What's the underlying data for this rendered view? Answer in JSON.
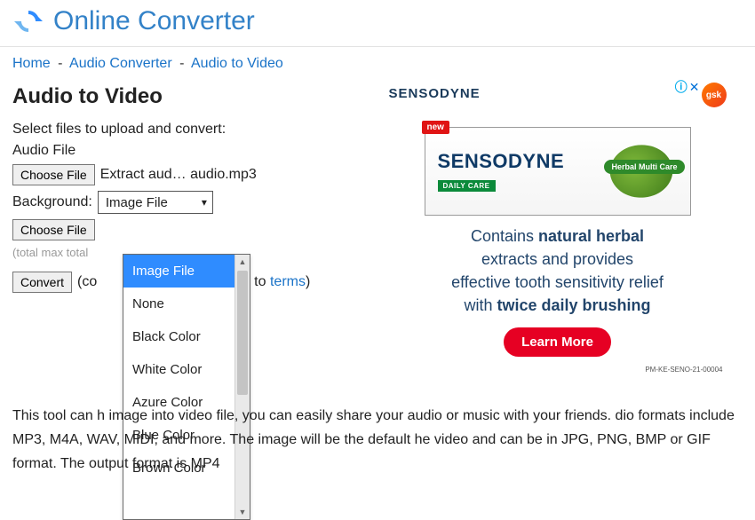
{
  "header": {
    "site_title": "Online Converter"
  },
  "breadcrumb": {
    "items": [
      "Home",
      "Audio Converter",
      "Audio to Video"
    ],
    "sep": "-"
  },
  "page": {
    "title": "Audio to Video",
    "select_prompt": "Select files to upload and convert:",
    "audio_label": "Audio File",
    "choose_file_label": "Choose File",
    "audio_filename": "Extract aud… audio.mp3",
    "background_label": "Background:",
    "background_selected": "Image File",
    "bg_choose_file_label": "Choose File",
    "total_note": "(total max total",
    "convert_label": "Convert",
    "consent_prefix": "(co",
    "consent_mid": "to ",
    "terms_label": "terms",
    "consent_suffix": ")"
  },
  "dropdown": {
    "options": [
      "Image File",
      "None",
      "Black Color",
      "White Color",
      "Azure Color",
      "Blue Color",
      "Brown Color"
    ],
    "selected_index": 0
  },
  "description": "This tool can                           h image into video file, you can easily share your audio or music with your friends.                          dio formats include MP3, M4A, WAV, MIDI, and more. The image will be the default                         he video and can be in JPG, PNG, BMP or GIF format. The output format is MP4",
  "ad": {
    "brand_top": "SENSODYNE",
    "gsk": "gsk",
    "new": "new",
    "prod_brand": "SENSODYNE",
    "prod_sub": "DAILY CARE",
    "herbal": "Herbal Multi Care",
    "copy_line1_a": "Contains ",
    "copy_line1_b": "natural herbal",
    "copy_line2": "extracts and provides",
    "copy_line3": "effective tooth sensitivity relief",
    "copy_line4_a": "with ",
    "copy_line4_b": "twice daily brushing",
    "cta": "Learn More",
    "code": "PM-KE-SENO-21-00004",
    "info": "ⓘ",
    "close": "✕"
  }
}
